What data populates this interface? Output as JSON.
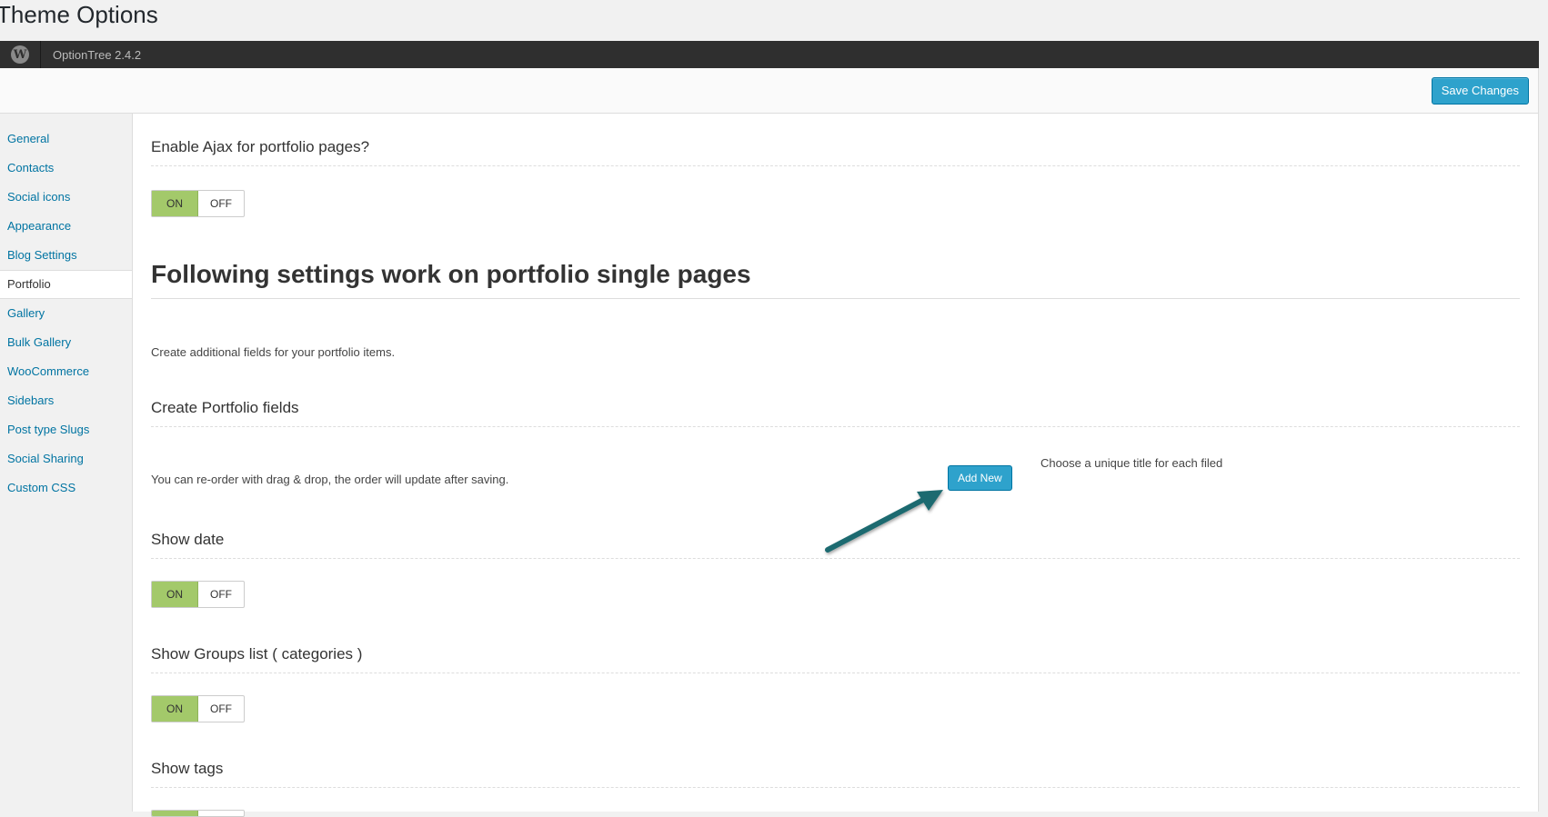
{
  "page_title": "Theme Options",
  "topbar": {
    "version": "OptionTree 2.4.2",
    "logo_letter": "W"
  },
  "header": {
    "save_label": "Save Changes"
  },
  "sidebar": {
    "items": [
      {
        "label": "General"
      },
      {
        "label": "Contacts"
      },
      {
        "label": "Social icons"
      },
      {
        "label": "Appearance"
      },
      {
        "label": "Blog Settings"
      },
      {
        "label": "Portfolio",
        "active": true
      },
      {
        "label": "Gallery"
      },
      {
        "label": "Bulk Gallery"
      },
      {
        "label": "WooCommerce"
      },
      {
        "label": "Sidebars"
      },
      {
        "label": "Post type Slugs"
      },
      {
        "label": "Social Sharing"
      },
      {
        "label": "Custom CSS"
      }
    ]
  },
  "main": {
    "ajax": {
      "title": "Enable Ajax for portfolio pages?",
      "on": "ON",
      "off": "OFF",
      "value": "ON"
    },
    "single_heading": "Following settings work on portfolio single pages",
    "additional_desc": "Create additional fields for your portfolio items.",
    "portfolio_fields": {
      "title": "Create Portfolio fields",
      "desc": "You can re-order with drag & drop, the order will update after saving.",
      "add_label": "Add New",
      "hint": "Choose a unique title for each filed"
    },
    "show_date": {
      "title": "Show date",
      "on": "ON",
      "off": "OFF",
      "value": "ON"
    },
    "show_groups": {
      "title": "Show Groups list ( categories )",
      "on": "ON",
      "off": "OFF",
      "value": "ON"
    },
    "show_tags": {
      "title": "Show tags"
    }
  },
  "colors": {
    "accent": "#2ea2cc",
    "toggle_on": "#a3c96a",
    "arrow": "#1e6b70",
    "topbar": "#2f2f2f"
  }
}
